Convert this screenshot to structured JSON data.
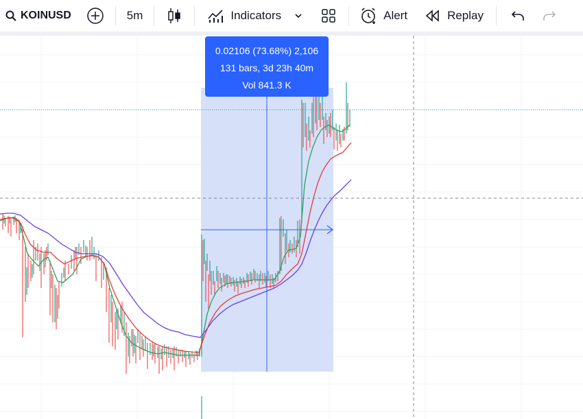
{
  "toolbar": {
    "symbol": "KOINUSD",
    "interval": "5m",
    "indicators_label": "Indicators",
    "alert_label": "Alert",
    "replay_label": "Replay"
  },
  "measure": {
    "line1": "0.02106 (73.68%) 2,106",
    "line2": "131 bars, 3d 23h 40m",
    "line3": "Vol 841.3 K",
    "change_percent": 73.68,
    "bars": 131
  },
  "colors": {
    "accent": "#2962ff",
    "selection": "#d4def9",
    "ma_fast": "#2e9e5b",
    "ma_mid": "#e53935",
    "ma_slow": "#6a3de8",
    "candle_up": "#26a69a",
    "candle_down": "#ef5350"
  },
  "icons": [
    "search-icon",
    "add-symbol-icon",
    "candles-icon",
    "indicators-icon",
    "chevron-down-icon",
    "layouts-icon",
    "alert-clock-icon",
    "replay-icon",
    "undo-icon",
    "redo-icon"
  ]
}
